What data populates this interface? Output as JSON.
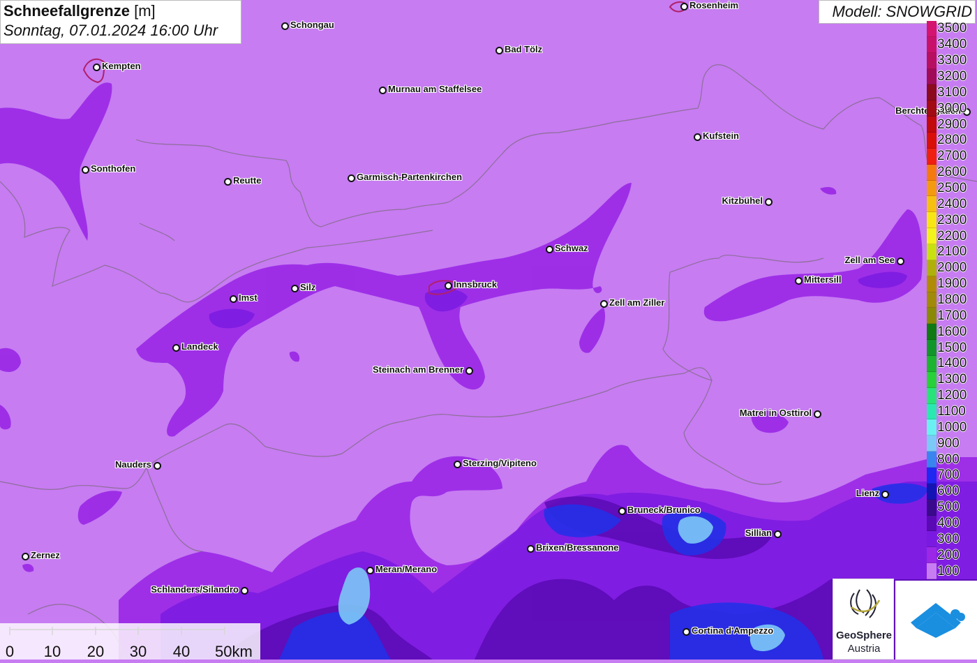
{
  "header": {
    "title": "Schneefallgrenze",
    "unit": "[m]",
    "datetime": "Sonntag, 07.01.2024 16:00 Uhr",
    "model": "Modell: SNOWGRID"
  },
  "legend": {
    "labels": [
      "3500",
      "3400",
      "3300",
      "3200",
      "3100",
      "3000",
      "2900",
      "2800",
      "2700",
      "2600",
      "2500",
      "2400",
      "2300",
      "2200",
      "2100",
      "2000",
      "1900",
      "1800",
      "1700",
      "1600",
      "1500",
      "1400",
      "1300",
      "1200",
      "1100",
      "1000",
      "900",
      "800",
      "700",
      "600",
      "500",
      "400",
      "300",
      "200",
      "100"
    ],
    "colors": [
      "#d4146e",
      "#c8126a",
      "#b81060",
      "#a00c58",
      "#8c0a1e",
      "#a20a14",
      "#c00a0c",
      "#d81008",
      "#f02010",
      "#f47a10",
      "#f49a10",
      "#f6c010",
      "#f8e614",
      "#f2f21c",
      "#c8e010",
      "#b0b00c",
      "#b08c06",
      "#a08a08",
      "#8a8a08",
      "#0f7a12",
      "#12962a",
      "#1cb430",
      "#28d03a",
      "#2ae27a",
      "#2ae8b0",
      "#6af0f0",
      "#7cc8f6",
      "#3a84f0",
      "#1e28f0",
      "#1414b4",
      "#3a0a8c",
      "#5a0ab4",
      "#7a1ae0",
      "#9a28e6",
      "#c87cf2"
    ]
  },
  "cities": [
    {
      "name": "Rosenheim"
    },
    {
      "name": "Schongau"
    },
    {
      "name": "Bad Tölz"
    },
    {
      "name": "Kempten"
    },
    {
      "name": "Murnau am Staffelsee"
    },
    {
      "name": "Berchtesgaden"
    },
    {
      "name": "Kufstein"
    },
    {
      "name": "Sonthofen"
    },
    {
      "name": "Reutte"
    },
    {
      "name": "Garmisch-Partenkirchen"
    },
    {
      "name": "Kitzbühel"
    },
    {
      "name": "Schwaz"
    },
    {
      "name": "Zell am See"
    },
    {
      "name": "Mittersill"
    },
    {
      "name": "Imst"
    },
    {
      "name": "Silz"
    },
    {
      "name": "Innsbruck"
    },
    {
      "name": "Zell am Ziller"
    },
    {
      "name": "Landeck"
    },
    {
      "name": "Steinach am Brenner"
    },
    {
      "name": "Matrei in Osttirol"
    },
    {
      "name": "Nauders"
    },
    {
      "name": "Sterzing/Vipiteno"
    },
    {
      "name": "Lienz"
    },
    {
      "name": "Bruneck/Brunico"
    },
    {
      "name": "Sillian"
    },
    {
      "name": "Brixen/Bressanone"
    },
    {
      "name": "Zernez"
    },
    {
      "name": "Meran/Merano"
    },
    {
      "name": "Schlanders/Silandro"
    },
    {
      "name": "Cortina d'Ampezzo"
    }
  ],
  "scalebar": {
    "labels": [
      "0",
      "10",
      "20",
      "30",
      "40",
      "50km"
    ]
  },
  "logos": {
    "geosphere_line1": "GeoSphere",
    "geosphere_line2": "Austria"
  },
  "colors": {
    "background": "#c77cf2",
    "band_200": "#9a28e6",
    "band_300": "#7a1ae0",
    "band_400": "#5a0ab4",
    "band_600": "#1e28f0",
    "band_800": "#3a84f0",
    "band_900": "#7cc8f6",
    "border": "#7a6a7a"
  }
}
